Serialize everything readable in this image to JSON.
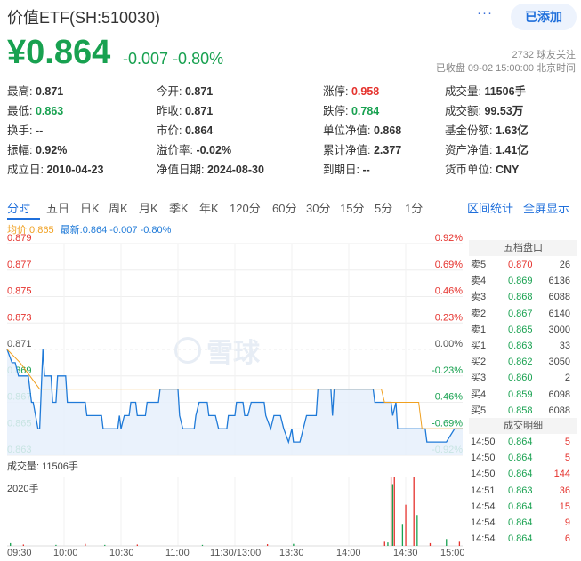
{
  "header": {
    "title": "价值ETF(SH:510030)",
    "more": "···",
    "add_label": "已添加",
    "price": "¥0.864",
    "change": "-0.007",
    "change_pct": "-0.80%",
    "followers": "2732 球友关注",
    "status": "已收盘 09-02 15:00:00 北京时间"
  },
  "quote": [
    {
      "label": "最高:",
      "value": "0.871",
      "color": ""
    },
    {
      "label": "今开:",
      "value": "0.871",
      "color": ""
    },
    {
      "label": "涨停:",
      "value": "0.958",
      "color": "up"
    },
    {
      "label": "成交量:",
      "value": "11506手",
      "color": ""
    },
    {
      "label": "最低:",
      "value": "0.863",
      "color": "dn"
    },
    {
      "label": "昨收:",
      "value": "0.871",
      "color": ""
    },
    {
      "label": "跌停:",
      "value": "0.784",
      "color": "dn"
    },
    {
      "label": "成交额:",
      "value": "99.53万",
      "color": ""
    },
    {
      "label": "换手:",
      "value": "--",
      "color": ""
    },
    {
      "label": "市价:",
      "value": "0.864",
      "color": ""
    },
    {
      "label": "单位净值:",
      "value": "0.868",
      "color": ""
    },
    {
      "label": "基金份额:",
      "value": "1.63亿",
      "color": ""
    },
    {
      "label": "振幅:",
      "value": "0.92%",
      "color": ""
    },
    {
      "label": "溢价率:",
      "value": "-0.02%",
      "color": ""
    },
    {
      "label": "累计净值:",
      "value": "2.377",
      "color": ""
    },
    {
      "label": "资产净值:",
      "value": "1.41亿",
      "color": ""
    },
    {
      "label": "成立日:",
      "value": "2010-04-23",
      "color": ""
    },
    {
      "label": "净值日期:",
      "value": "2024-08-30",
      "color": ""
    },
    {
      "label": "到期日:",
      "value": "--",
      "color": ""
    },
    {
      "label": "货币单位:",
      "value": "CNY",
      "color": ""
    }
  ],
  "tabs": [
    "分时",
    "五日",
    "日K",
    "周K",
    "月K",
    "季K",
    "年K",
    "120分",
    "60分",
    "30分",
    "15分",
    "5分",
    "1分"
  ],
  "tab_right": [
    "区间统计",
    "全屏显示"
  ],
  "legend": {
    "avg": "均价:0.865",
    "latest": "最新:0.864 -0.007 -0.80%"
  },
  "watermark": "雪球",
  "chart_data": {
    "type": "line",
    "y_left": [
      "0.879",
      "0.877",
      "0.875",
      "0.873",
      "0.871",
      "0.869",
      "0.867",
      "0.865",
      "0.863"
    ],
    "y_right": [
      "0.92%",
      "0.69%",
      "0.46%",
      "0.23%",
      "0.00%",
      "-0.23%",
      "-0.46%",
      "-0.69%",
      "-0.92%"
    ],
    "ylim": [
      0.863,
      0.879
    ],
    "x_labels": [
      "09:30",
      "10:00",
      "10:30",
      "11:00",
      "11:30/13:00",
      "13:30",
      "14:00",
      "14:30",
      "15:00"
    ],
    "price_series": [
      [
        0,
        0.871
      ],
      [
        3,
        0.87
      ],
      [
        5,
        0.87
      ],
      [
        7,
        0.869
      ],
      [
        13,
        0.869
      ],
      [
        15,
        0.867
      ],
      [
        16,
        0.867
      ],
      [
        19,
        0.865
      ],
      [
        20,
        0.865
      ],
      [
        22,
        0.871
      ],
      [
        23,
        0.869
      ],
      [
        27,
        0.869
      ],
      [
        28,
        0.867
      ],
      [
        30,
        0.867
      ],
      [
        31,
        0.869
      ],
      [
        36,
        0.869
      ],
      [
        37,
        0.867
      ],
      [
        48,
        0.867
      ],
      [
        49,
        0.866
      ],
      [
        58,
        0.866
      ],
      [
        59,
        0.865
      ],
      [
        68,
        0.865
      ],
      [
        69,
        0.866
      ],
      [
        70,
        0.865
      ],
      [
        72,
        0.866
      ],
      [
        75,
        0.866
      ],
      [
        76,
        0.867
      ],
      [
        79,
        0.867
      ],
      [
        80,
        0.866
      ],
      [
        85,
        0.866
      ],
      [
        86,
        0.867
      ],
      [
        93,
        0.867
      ],
      [
        94,
        0.868
      ],
      [
        105,
        0.868
      ],
      [
        106,
        0.866
      ],
      [
        108,
        0.865
      ],
      [
        115,
        0.865
      ],
      [
        116,
        0.866
      ],
      [
        118,
        0.867
      ],
      [
        123,
        0.867
      ],
      [
        124,
        0.866
      ],
      [
        128,
        0.866
      ],
      [
        130,
        0.865
      ],
      [
        135,
        0.865
      ],
      [
        136,
        0.866
      ],
      [
        140,
        0.866
      ],
      [
        141,
        0.867
      ],
      [
        145,
        0.867
      ],
      [
        146,
        0.866
      ],
      [
        148,
        0.866
      ],
      [
        150,
        0.867
      ],
      [
        158,
        0.867
      ],
      [
        159,
        0.866
      ],
      [
        162,
        0.865
      ],
      [
        164,
        0.866
      ],
      [
        168,
        0.866
      ],
      [
        170,
        0.865
      ],
      [
        173,
        0.864
      ],
      [
        175,
        0.865
      ],
      [
        176,
        0.864
      ],
      [
        180,
        0.864
      ],
      [
        182,
        0.865
      ],
      [
        184,
        0.866
      ],
      [
        190,
        0.866
      ],
      [
        191,
        0.868
      ],
      [
        199,
        0.868
      ],
      [
        200,
        0.866
      ],
      [
        201,
        0.868
      ],
      [
        225,
        0.868
      ],
      [
        226,
        0.867
      ],
      [
        236,
        0.867
      ],
      [
        237,
        0.866
      ],
      [
        239,
        0.867
      ],
      [
        240,
        0.865
      ],
      [
        255,
        0.865
      ],
      [
        257,
        0.865
      ],
      [
        258,
        0.864
      ],
      [
        262,
        0.864
      ],
      [
        263,
        0.864
      ],
      [
        267,
        0.864
      ],
      [
        268,
        0.864
      ],
      [
        270,
        0.864
      ],
      [
        275,
        0.865
      ],
      [
        280,
        0.865
      ]
    ],
    "avg_series": [
      [
        0,
        0.871
      ],
      [
        8,
        0.87
      ],
      [
        20,
        0.868
      ],
      [
        230,
        0.868
      ],
      [
        232,
        0.867
      ],
      [
        253,
        0.867
      ],
      [
        255,
        0.865
      ],
      [
        280,
        0.865
      ]
    ],
    "volume_label": "成交量: 11506手",
    "volume_max": "2020手",
    "volume_bars": [
      [
        2,
        80,
        "dn"
      ],
      [
        10,
        40,
        "up"
      ],
      [
        30,
        30,
        "dn"
      ],
      [
        48,
        60,
        "up"
      ],
      [
        60,
        30,
        "dn"
      ],
      [
        80,
        40,
        "up"
      ],
      [
        120,
        30,
        "dn"
      ],
      [
        160,
        50,
        "up"
      ],
      [
        176,
        60,
        "dn"
      ],
      [
        232,
        120,
        "up"
      ],
      [
        234,
        100,
        "dn"
      ],
      [
        236,
        2020,
        "up"
      ],
      [
        237,
        1800,
        "dn"
      ],
      [
        238,
        2000,
        "up"
      ],
      [
        243,
        640,
        "dn"
      ],
      [
        245,
        1200,
        "up"
      ],
      [
        250,
        2000,
        "up"
      ],
      [
        252,
        900,
        "dn"
      ],
      [
        260,
        80,
        "up"
      ],
      [
        270,
        200,
        "dn"
      ],
      [
        278,
        120,
        "up"
      ]
    ]
  },
  "orderbook": {
    "title": "五档盘口",
    "rows": [
      {
        "side": "卖5",
        "price": "0.870",
        "vol": "26",
        "color": "up"
      },
      {
        "side": "卖4",
        "price": "0.869",
        "vol": "6136",
        "color": "dn"
      },
      {
        "side": "卖3",
        "price": "0.868",
        "vol": "6088",
        "color": "dn"
      },
      {
        "side": "卖2",
        "price": "0.867",
        "vol": "6140",
        "color": "dn"
      },
      {
        "side": "卖1",
        "price": "0.865",
        "vol": "3000",
        "color": "dn"
      },
      {
        "side": "买1",
        "price": "0.863",
        "vol": "33",
        "color": "dn"
      },
      {
        "side": "买2",
        "price": "0.862",
        "vol": "3050",
        "color": "dn"
      },
      {
        "side": "买3",
        "price": "0.860",
        "vol": "2",
        "color": "dn"
      },
      {
        "side": "买4",
        "price": "0.859",
        "vol": "6098",
        "color": "dn"
      },
      {
        "side": "买5",
        "price": "0.858",
        "vol": "6088",
        "color": "dn"
      }
    ]
  },
  "trades": {
    "title": "成交明细",
    "rows": [
      {
        "time": "14:50",
        "price": "0.864",
        "vol": "5"
      },
      {
        "time": "14:50",
        "price": "0.864",
        "vol": "5"
      },
      {
        "time": "14:50",
        "price": "0.864",
        "vol": "144"
      },
      {
        "time": "14:51",
        "price": "0.863",
        "vol": "36"
      },
      {
        "time": "14:54",
        "price": "0.864",
        "vol": "15"
      },
      {
        "time": "14:54",
        "price": "0.864",
        "vol": "9"
      },
      {
        "time": "14:54",
        "price": "0.864",
        "vol": "6"
      }
    ]
  }
}
